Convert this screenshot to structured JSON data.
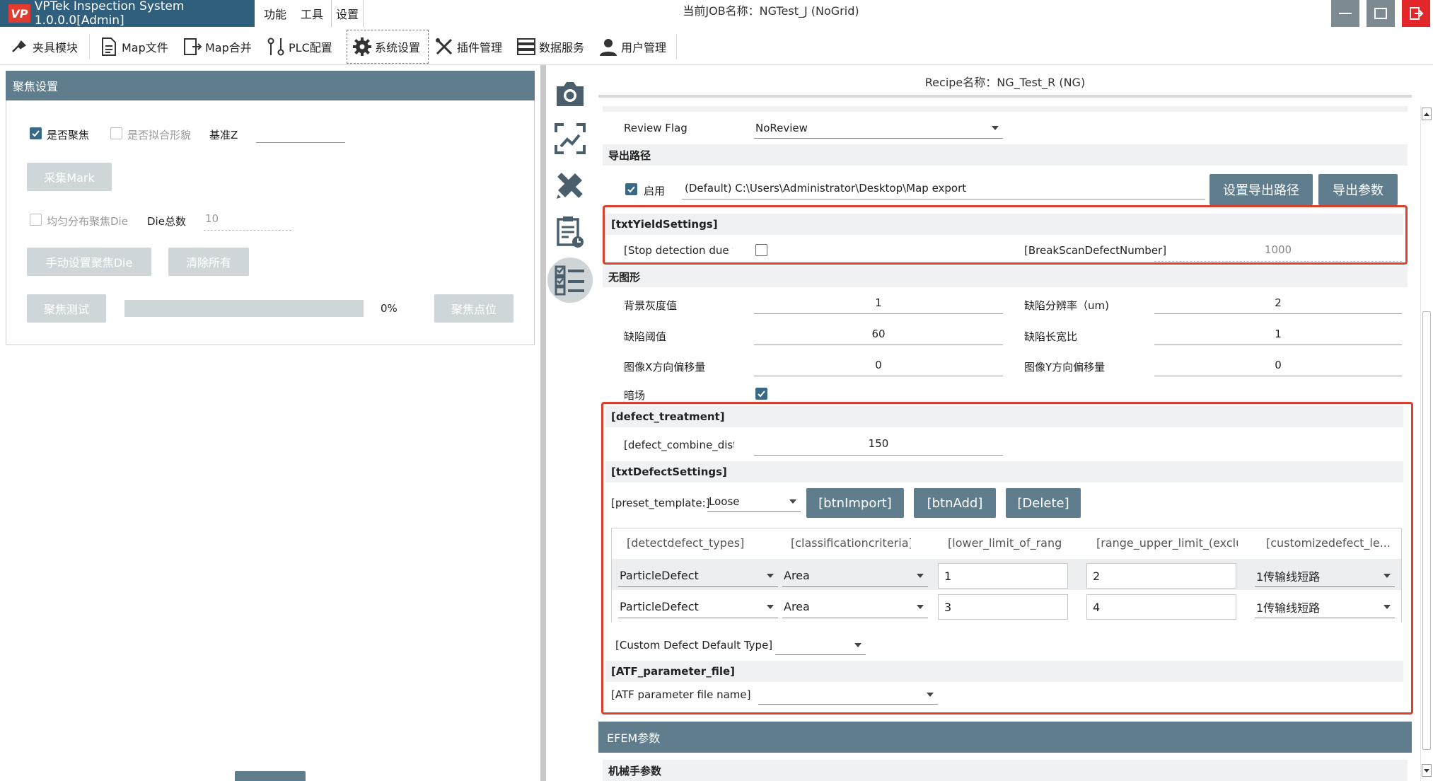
{
  "app": {
    "title": "VPTek Inspection System 1.0.0.0[Admin]",
    "logo": "VP",
    "menu": [
      "功能",
      "工具",
      "设置"
    ],
    "job_title": "当前JOB名称：NGTest_J (NoGrid)"
  },
  "toolbar": {
    "items": [
      {
        "label": "夹具模块",
        "icon": "fixture-icon"
      },
      {
        "label": "Map文件",
        "icon": "document-icon"
      },
      {
        "label": "Map合并",
        "icon": "merge-icon"
      },
      {
        "label": "PLC配置",
        "icon": "plc-icon"
      },
      {
        "label": "系统设置",
        "icon": "gear-icon"
      },
      {
        "label": "插件管理",
        "icon": "tools-icon"
      },
      {
        "label": "数据服务",
        "icon": "server-icon"
      },
      {
        "label": "用户管理",
        "icon": "user-icon"
      }
    ]
  },
  "left": {
    "header": "聚焦设置",
    "focus_enabled": "是否聚焦",
    "fit_shape": "是否拟合形貌",
    "base_z": "基准Z",
    "collect_mark": "采集Mark",
    "uniform_die": "均匀分布聚焦Die",
    "die_total_label": "Die总数",
    "die_total_value": "10",
    "manual_set": "手动设置聚焦Die",
    "clear_all": "清除所有",
    "focus_test": "聚焦测试",
    "progress_text": "0%",
    "progress": 0,
    "focus_point": "聚焦点位"
  },
  "right": {
    "recipe": "Recipe名称：NG_Test_R (NG)",
    "review_flag_label": "Review Flag",
    "review_flag_value": "NoReview",
    "export_section": "导出路径",
    "export_enabled": "启用",
    "export_path": "(Default) C:\\Users\\Administrator\\Desktop\\Map export",
    "set_export_btn": "设置导出路径",
    "export_params_btn": "导出参数",
    "yield_section": "[txtYieldSettings]",
    "stop_detection": "[Stop detection due t",
    "break_scan_label": "[BreakScanDefectNumber]",
    "break_scan_value": "1000",
    "no_pattern_section": "无图形",
    "bg_gray_label": "背景灰度值",
    "bg_gray_value": "1",
    "defect_res_label": "缺陷分辨率（um)",
    "defect_res_value": "2",
    "defect_thr_label": "缺陷阈值",
    "defect_thr_value": "60",
    "defect_ratio_label": "缺陷长宽比",
    "defect_ratio_value": "1",
    "img_x_label": "图像X方向偏移量",
    "img_x_value": "0",
    "img_y_label": "图像Y方向偏移量",
    "img_y_value": "0",
    "dark_field_label": "暗场",
    "defect_treatment_section": "[defect_treatment]",
    "combine_dist_label": "[defect_combine_dist",
    "combine_dist_value": "150",
    "defect_settings_section": "[txtDefectSettings]",
    "preset_label": "[preset_template:]",
    "preset_value": "Loose",
    "btn_import": "[btnImport]",
    "btn_add": "[btnAdd]",
    "btn_delete": "[Delete]",
    "table": {
      "columns": [
        "[detectdefect_types]",
        "[classificationcriteria]",
        "[lower_limit_of_rang",
        "[range_upper_limit_(exclu",
        "[customizedefect_le..."
      ],
      "rows": [
        {
          "type": "ParticleDefect",
          "criteria": "Area",
          "lower": "1",
          "upper": "2",
          "custom": "1传输线短路"
        },
        {
          "type": "ParticleDefect",
          "criteria": "Area",
          "lower": "3",
          "upper": "4",
          "custom": "1传输线短路"
        }
      ]
    },
    "custom_default_label": "[Custom Defect Default Type]",
    "atf_section": "[ATF_parameter_file]",
    "atf_name_label": "[ATF parameter file name]",
    "efem_header": "EFEM参数",
    "robot_section": "机械手参数"
  }
}
